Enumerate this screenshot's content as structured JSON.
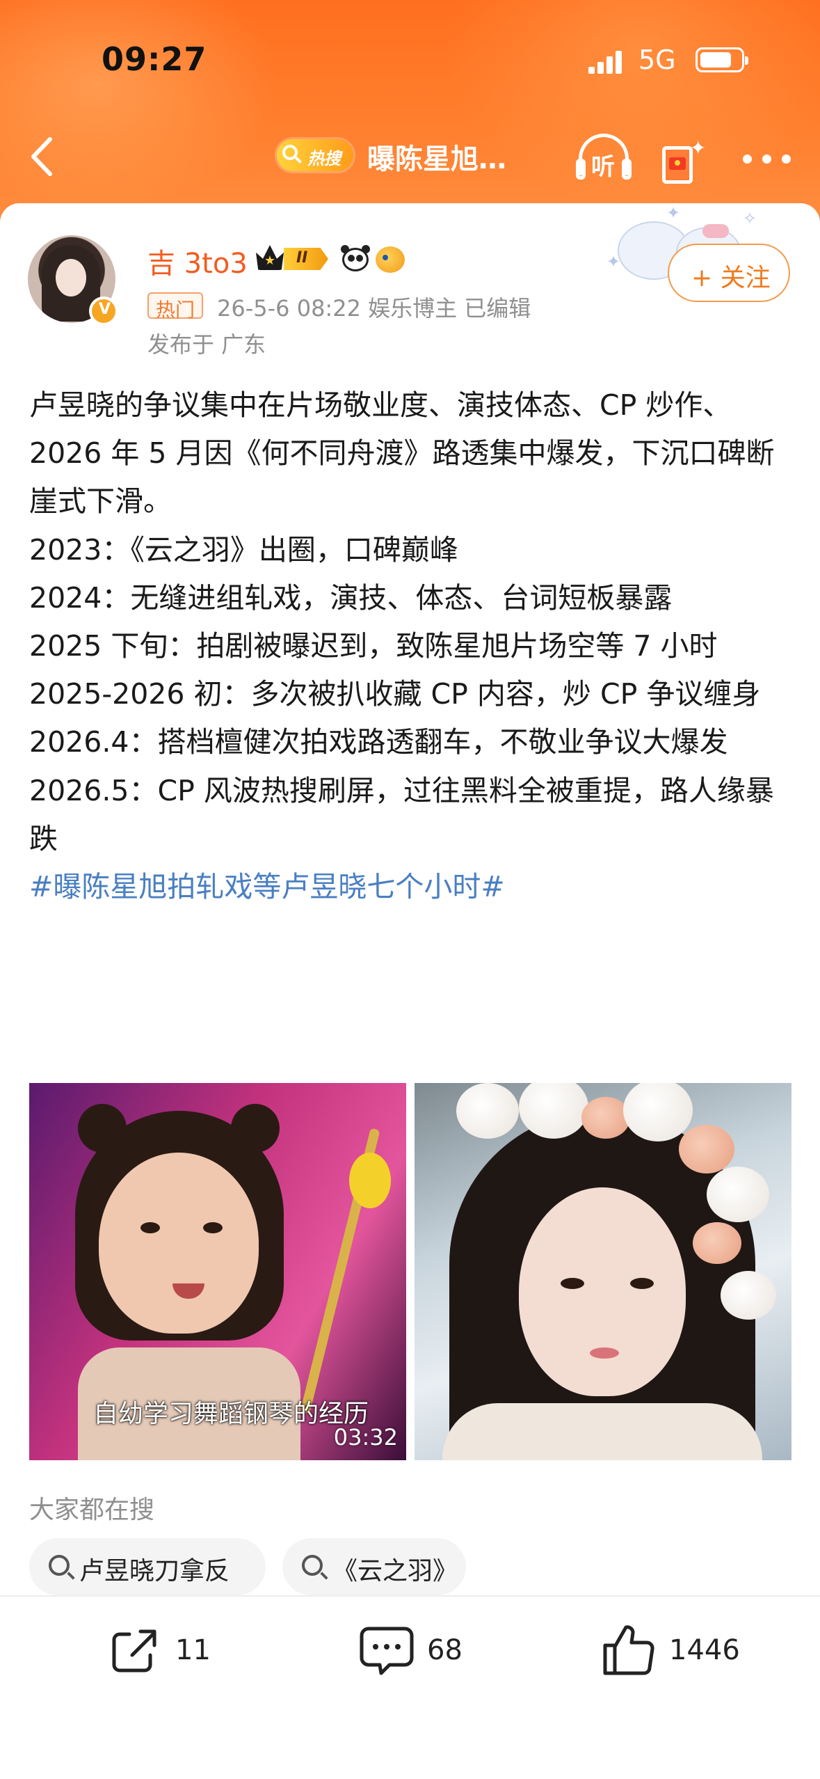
{
  "status_bar": {
    "time": "09:27",
    "network": "5G"
  },
  "header": {
    "hot_badge": "热搜",
    "title": "曝陈星旭…",
    "listen_label": "听"
  },
  "author": {
    "name": "吉 3to3",
    "level": "II",
    "tag": "热门",
    "meta": "26-5-6 08:22  娱乐博主  已编辑",
    "location": "发布于 广东",
    "follow_label": "+ 关注"
  },
  "post": {
    "paragraphs": [
      "卢昱晓的争议集中在片场敬业度、演技体态、CP 炒作、2026 年 5 月因《何不同舟渡》路透集中爆发，下沉口碑断崖式下滑。",
      "2023：《云之羽》出圈，口碑巅峰",
      "2024：无缝进组轧戏，演技、体态、台词短板暴露",
      "2025 下旬：拍剧被曝迟到，致陈星旭片场空等 7 小时",
      "2025-2026 初：多次被扒收藏 CP 内容，炒 CP 争议缠身",
      "2026.4：搭档檀健次拍戏路透翻车，不敬业争议大爆发",
      "2026.5：CP 风波热搜刷屏，过往黑料全被重提，路人缘暴跌"
    ],
    "hashtag": "#曝陈星旭拍轧戏等卢昱晓七个小时#"
  },
  "media": {
    "video_caption": "自幼学习舞蹈钢琴的经历",
    "video_duration": "03:32"
  },
  "search_section": {
    "label": "大家都在搜",
    "chips": [
      "卢昱晓刀拿反",
      "《云之羽》"
    ]
  },
  "actions": {
    "shares": "11",
    "comments": "68",
    "likes": "1446"
  },
  "colors": {
    "accent": "#ff7a2a",
    "username": "#f35c1f",
    "hashtag": "#4a7fc1"
  }
}
